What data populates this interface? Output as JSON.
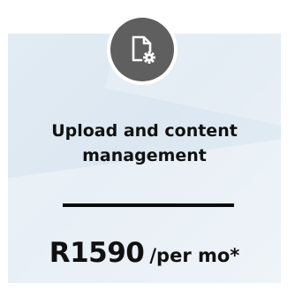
{
  "card": {
    "title": "Upload and content management",
    "price": "R1590",
    "period": "/per mo*"
  },
  "icons": {
    "badge_icon": "document-settings-icon"
  },
  "colors": {
    "card_background": "#dfe9f2",
    "icon_circle": "#5f5f5f",
    "text": "#111111",
    "divider": "#0b0b0b"
  }
}
